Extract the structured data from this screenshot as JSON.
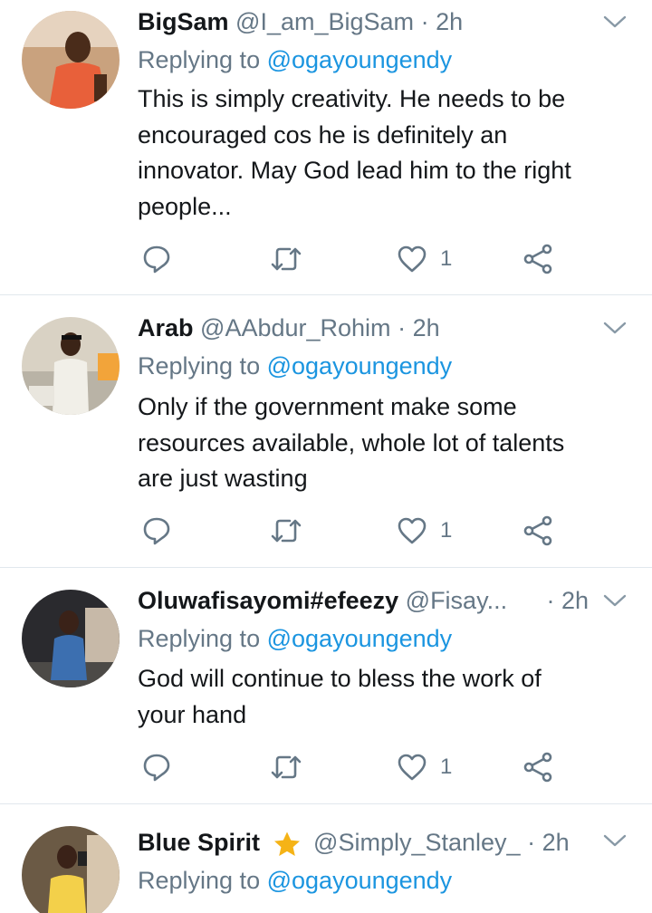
{
  "tweets": [
    {
      "name": "BigSam",
      "handle": "@I_am_BigSam",
      "time": "2h",
      "replying_prefix": "Replying to",
      "replying_to": "@ogayoungendy",
      "text_lines": [
        "This is simply creativity. He needs to be",
        "encouraged cos he is definitely an",
        "innovator. May God lead him to the right",
        "people..."
      ],
      "likes": "1"
    },
    {
      "name": "Arab",
      "handle": "@AAbdur_Rohim",
      "time": "2h",
      "replying_prefix": "Replying to",
      "replying_to": "@ogayoungendy",
      "text_lines": [
        "Only if the government make some",
        "resources available, whole lot of talents",
        "are just wasting"
      ],
      "likes": "1"
    },
    {
      "name": "Oluwafisayomi#efeezy",
      "handle": "@Fisay...",
      "time": "2h",
      "replying_prefix": "Replying to",
      "replying_to": "@ogayoungendy",
      "text_lines": [
        "God will continue to bless the work of",
        "your hand"
      ],
      "likes": "1"
    },
    {
      "name": "Blue Spirit",
      "handle": "@Simply_Stanley_",
      "time": "2h",
      "replying_prefix": "Replying to",
      "replying_to": "@ogayoungendy",
      "text_lines": [],
      "likes": ""
    }
  ],
  "icons": {
    "reply": "reply-icon",
    "retweet": "retweet-icon",
    "like": "heart-icon",
    "share": "share-icon",
    "menu": "chevron-down-icon",
    "badge": "star-icon"
  },
  "colors": {
    "text": "#14171a",
    "secondary": "#657786",
    "link": "#1b95e0",
    "divider": "#e1e8ed",
    "star": "#f5b316"
  },
  "separator": "·"
}
